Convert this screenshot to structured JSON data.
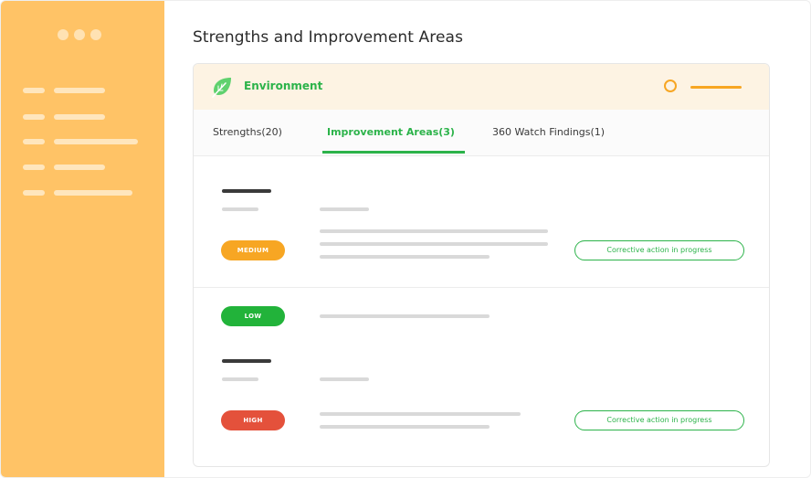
{
  "page": {
    "title": "Strengths and Improvement Areas"
  },
  "card": {
    "header_title": "Environment",
    "header_icon": "leaf-icon"
  },
  "tabs": [
    {
      "label": "Strengths(20)",
      "active": false
    },
    {
      "label": "Improvement Areas(3)",
      "active": true
    },
    {
      "label": "360 Watch Findings(1)",
      "active": false
    }
  ],
  "items": [
    {
      "severity": "MEDIUM",
      "status": "Corrective action in progress"
    },
    {
      "severity": "LOW",
      "status": ""
    },
    {
      "severity": "HIGH",
      "status": "Corrective action in progress"
    }
  ],
  "colors": {
    "sidebar": "#ffc366",
    "accent_green": "#2cb34a",
    "medium": "#f7a623",
    "low": "#22b33a",
    "high": "#e4513b"
  }
}
